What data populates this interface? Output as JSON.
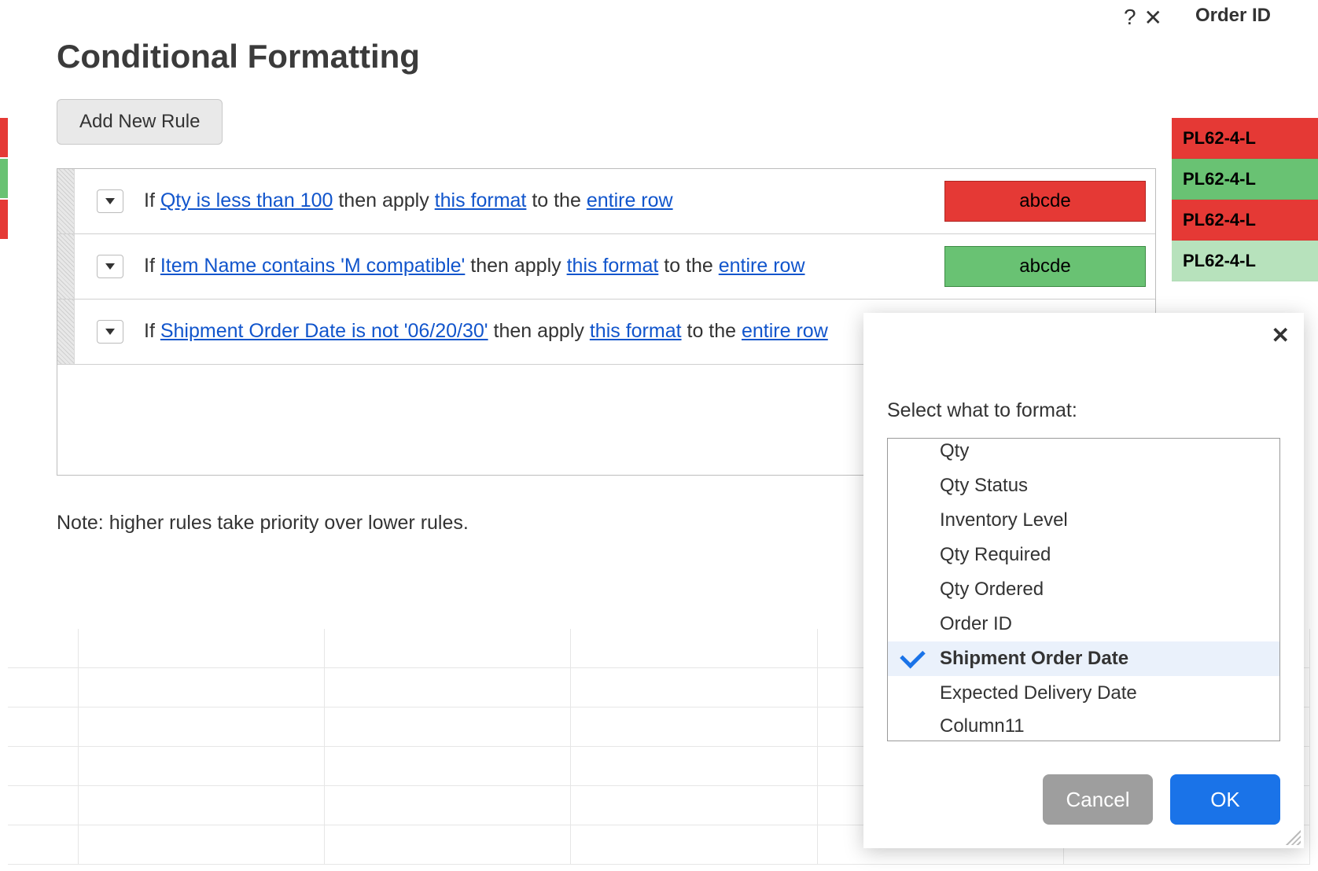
{
  "dialog": {
    "title": "Conditional Formatting",
    "help_icon": "?",
    "close_icon": "✕",
    "add_rule": "Add New Rule",
    "note": "Note: higher rules take priority over lower rules.",
    "sample_text": "abcde"
  },
  "rules": [
    {
      "prefix": "If ",
      "cond": "Qty is less than 100",
      "mid1": " then apply ",
      "fmt": "this format",
      "mid2": " to the ",
      "scope": "entire row",
      "swatch_class": "red"
    },
    {
      "prefix": "If ",
      "cond": "Item Name contains 'M compatible'",
      "mid1": " then apply ",
      "fmt": "this format",
      "mid2": " to the ",
      "scope": "entire row",
      "swatch_class": "green"
    },
    {
      "prefix": "If ",
      "cond": "Shipment Order Date is not '06/20/30'",
      "mid1": " then apply ",
      "fmt": "this format",
      "mid2": " to the ",
      "scope": "entire row",
      "swatch_class": ""
    }
  ],
  "sheet": {
    "order_id_header": "Order ID",
    "rows": [
      {
        "id": "PL62-4-L",
        "cls": "rc-red"
      },
      {
        "id": "PL62-4-L",
        "cls": "rc-green"
      },
      {
        "id": "PL62-4-L",
        "cls": "rc-red"
      },
      {
        "id": "PL62-4-L",
        "cls": "rc-light"
      }
    ]
  },
  "popover": {
    "close": "✕",
    "label": "Select what to format:",
    "items": [
      {
        "label": "Qty",
        "selected": false
      },
      {
        "label": "Qty Status",
        "selected": false
      },
      {
        "label": "Inventory Level",
        "selected": false
      },
      {
        "label": "Qty Required",
        "selected": false
      },
      {
        "label": "Qty Ordered",
        "selected": false
      },
      {
        "label": "Order ID",
        "selected": false
      },
      {
        "label": "Shipment Order Date",
        "selected": true
      },
      {
        "label": "Expected Delivery Date",
        "selected": false
      },
      {
        "label": "Column11",
        "selected": false
      }
    ],
    "cancel": "Cancel",
    "ok": "OK"
  }
}
